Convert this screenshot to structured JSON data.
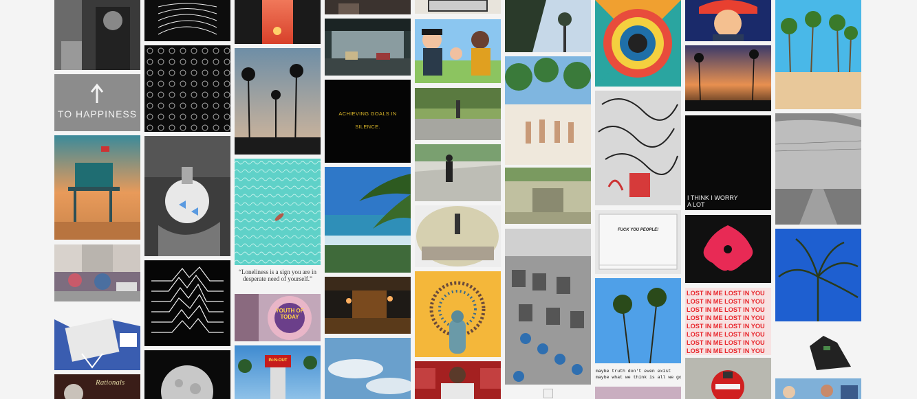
{
  "tiles": {
    "happiness": "TO HAPPINESS",
    "goals": "ACHIEVING GOALS IN SILENCE.",
    "loneliness": "“Loneliness is a sign you are in desperate need of yourself.”",
    "youth": "YOUTH OF TODAY",
    "fuck": "FUCK YOU PEOPLE!",
    "worry": "I THINK I WORRY A LOT",
    "lost_line": "LOST IN ME LOST IN YOU",
    "truth_line1": "maybe truth don't even exist",
    "truth_line2": "maybe what we think is all we got",
    "rationals": "Rationals",
    "inn": "IN-N-OUT"
  },
  "colors": {
    "background": "#f4f4f4",
    "lost_red": "#e8262c",
    "goals_yellow": "#d8b52a",
    "peacock_yellow": "#f4b73a"
  }
}
